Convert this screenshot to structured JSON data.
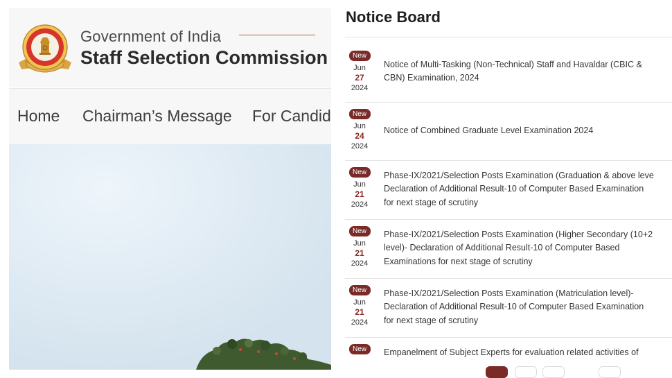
{
  "site": {
    "gov_line": "Government of India",
    "org_name": "Staff Selection Commission",
    "nav": [
      "Home",
      "Chairman’s Message",
      "For Candid"
    ]
  },
  "notice_board": {
    "title": "Notice Board",
    "badge": "New",
    "notices": [
      {
        "month": "Jun",
        "day": "27",
        "year": "2024",
        "lines": [
          "Notice of Multi-Tasking (Non-Technical) Staff and Havaldar (CBIC &",
          "CBN) Examination, 2024"
        ]
      },
      {
        "month": "Jun",
        "day": "24",
        "year": "2024",
        "lines": [
          "Notice of Combined Graduate Level Examination 2024"
        ]
      },
      {
        "month": "Jun",
        "day": "21",
        "year": "2024",
        "lines": [
          "Phase-IX/2021/Selection Posts Examination (Graduation & above leve",
          "Declaration of Additional Result-10 of Computer Based Examination",
          "for next stage of scrutiny"
        ]
      },
      {
        "month": "Jun",
        "day": "21",
        "year": "2024",
        "lines": [
          "Phase-IX/2021/Selection Posts Examination (Higher Secondary (10+2",
          "level)- Declaration of Additional Result-10 of Computer Based",
          "Examinations for next stage of scrutiny"
        ]
      },
      {
        "month": "Jun",
        "day": "21",
        "year": "2024",
        "lines": [
          "Phase-IX/2021/Selection Posts Examination (Matriculation level)-",
          "Declaration of Additional Result-10 of Computer Based Examination",
          "for next stage of scrutiny"
        ]
      },
      {
        "month": "",
        "day": "",
        "year": "",
        "lines": [
          "Empanelment of Subject Experts for evaluation related activities of"
        ]
      }
    ]
  },
  "colors": {
    "badge_bg": "#7a2b27",
    "day_text": "#8b2a25",
    "accent_rule": "#b5584a",
    "header_bg": "#f7f7f7"
  },
  "icons": {
    "emblem": "ssc-emblem-icon"
  }
}
